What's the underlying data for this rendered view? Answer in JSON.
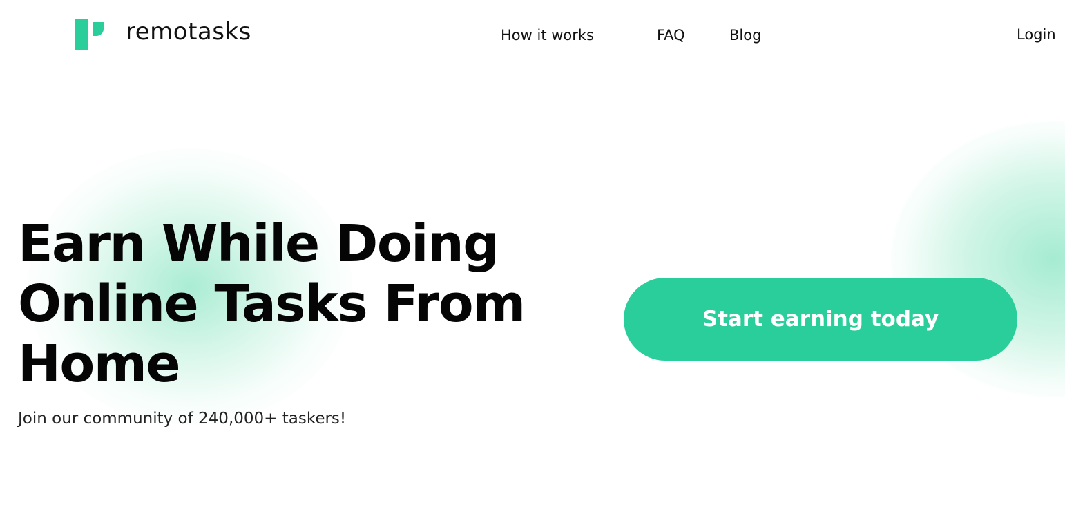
{
  "brand": {
    "name": "remotasks",
    "accent_color": "#2ace9b",
    "logo_icon": "remotasks-logo-icon"
  },
  "nav": {
    "items": [
      {
        "label": "How it works"
      },
      {
        "label": "FAQ"
      },
      {
        "label": "Blog"
      }
    ],
    "login_label": "Login"
  },
  "hero": {
    "title": "Earn While Doing Online Tasks From Home",
    "subtitle": "Join our community of 240,000+ taskers!",
    "cta_label": "Start earning today"
  }
}
